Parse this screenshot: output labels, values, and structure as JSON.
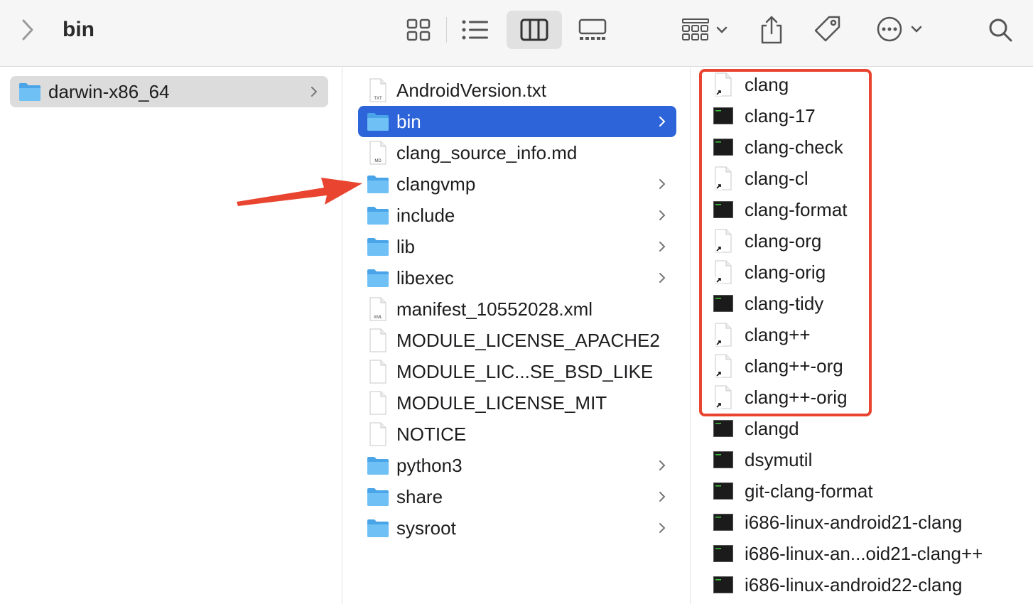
{
  "toolbar": {
    "title": "bin",
    "icons": [
      "chevron-right-icon",
      "icon-view-icon",
      "list-view-icon",
      "column-view-icon",
      "gallery-view-icon",
      "group-icon",
      "share-icon",
      "tag-icon",
      "more-icon",
      "search-icon"
    ]
  },
  "column1": {
    "items": [
      {
        "label": "darwin-x86_64",
        "type": "folder",
        "selected": true
      }
    ]
  },
  "column2": {
    "items": [
      {
        "label": "AndroidVersion.txt",
        "type": "txt"
      },
      {
        "label": "bin",
        "type": "folder",
        "selected": true
      },
      {
        "label": "clang_source_info.md",
        "type": "md"
      },
      {
        "label": "clangvmp",
        "type": "folder"
      },
      {
        "label": "include",
        "type": "folder"
      },
      {
        "label": "lib",
        "type": "folder"
      },
      {
        "label": "libexec",
        "type": "folder"
      },
      {
        "label": "manifest_10552028.xml",
        "type": "xml"
      },
      {
        "label": "MODULE_LICENSE_APACHE2",
        "type": "blank"
      },
      {
        "label": "MODULE_LIC...SE_BSD_LIKE",
        "type": "blank"
      },
      {
        "label": "MODULE_LICENSE_MIT",
        "type": "blank"
      },
      {
        "label": "NOTICE",
        "type": "blank"
      },
      {
        "label": "python3",
        "type": "folder"
      },
      {
        "label": "share",
        "type": "folder"
      },
      {
        "label": "sysroot",
        "type": "folder"
      }
    ],
    "file_icon_badges": {
      "txt": "TXT",
      "md": "MD",
      "xml": "XML"
    }
  },
  "column3": {
    "items": [
      {
        "label": "clang",
        "type": "alias"
      },
      {
        "label": "clang-17",
        "type": "exec"
      },
      {
        "label": "clang-check",
        "type": "exec"
      },
      {
        "label": "clang-cl",
        "type": "alias"
      },
      {
        "label": "clang-format",
        "type": "exec"
      },
      {
        "label": "clang-org",
        "type": "alias"
      },
      {
        "label": "clang-orig",
        "type": "alias"
      },
      {
        "label": "clang-tidy",
        "type": "exec"
      },
      {
        "label": "clang++",
        "type": "alias"
      },
      {
        "label": "clang++-org",
        "type": "alias"
      },
      {
        "label": "clang++-orig",
        "type": "alias"
      },
      {
        "label": "clangd",
        "type": "exec"
      },
      {
        "label": "dsymutil",
        "type": "exec"
      },
      {
        "label": "git-clang-format",
        "type": "exec"
      },
      {
        "label": "i686-linux-android21-clang",
        "type": "exec"
      },
      {
        "label": "i686-linux-an...oid21-clang++",
        "type": "exec"
      },
      {
        "label": "i686-linux-android22-clang",
        "type": "exec"
      }
    ]
  },
  "annotations": {
    "highlight_color": "#e8442f",
    "highlighted_items": "column3.items[0..10]",
    "arrow_target": "column2.items[3]"
  },
  "colors": {
    "selection": "#2e64d9",
    "folder": "#5ab3f0",
    "accent": "#e8442f"
  }
}
